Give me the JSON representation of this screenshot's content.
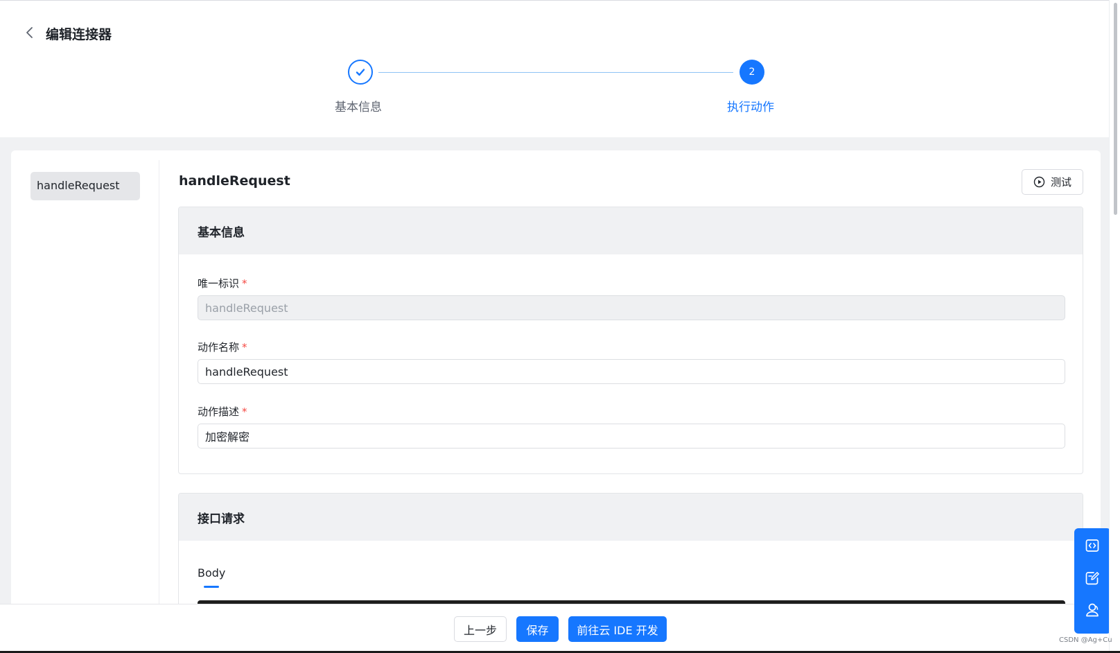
{
  "header": {
    "title": "编辑连接器"
  },
  "steps": [
    {
      "number": "1",
      "label": "基本信息",
      "status": "done"
    },
    {
      "number": "2",
      "label": "执行动作",
      "status": "active"
    }
  ],
  "sidebar": {
    "items": [
      {
        "label": "handleRequest",
        "selected": true
      }
    ]
  },
  "action": {
    "title": "handleRequest",
    "test_label": "测试"
  },
  "basic_info": {
    "title": "基本信息",
    "fields": [
      {
        "label": "唯一标识",
        "required_mark": "*",
        "value": "handleRequest",
        "disabled": true
      },
      {
        "label": "动作名称",
        "required_mark": "*",
        "value": "handleRequest",
        "disabled": false
      },
      {
        "label": "动作描述",
        "required_mark": "*",
        "value": "加密解密",
        "disabled": false
      }
    ]
  },
  "request": {
    "title": "接口请求",
    "tabs": [
      {
        "label": "Body",
        "active": true
      }
    ]
  },
  "footer": {
    "prev_label": "上一步",
    "save_label": "保存",
    "ide_label": "前往云 IDE 开发"
  },
  "float_tools": [
    "code-icon",
    "edit-icon",
    "contact-icon"
  ],
  "watermark": "CSDN @Ag+Cu",
  "colors": {
    "primary": "#1677ff",
    "required": "#f54a45",
    "section_header": "#f0f1f3"
  }
}
